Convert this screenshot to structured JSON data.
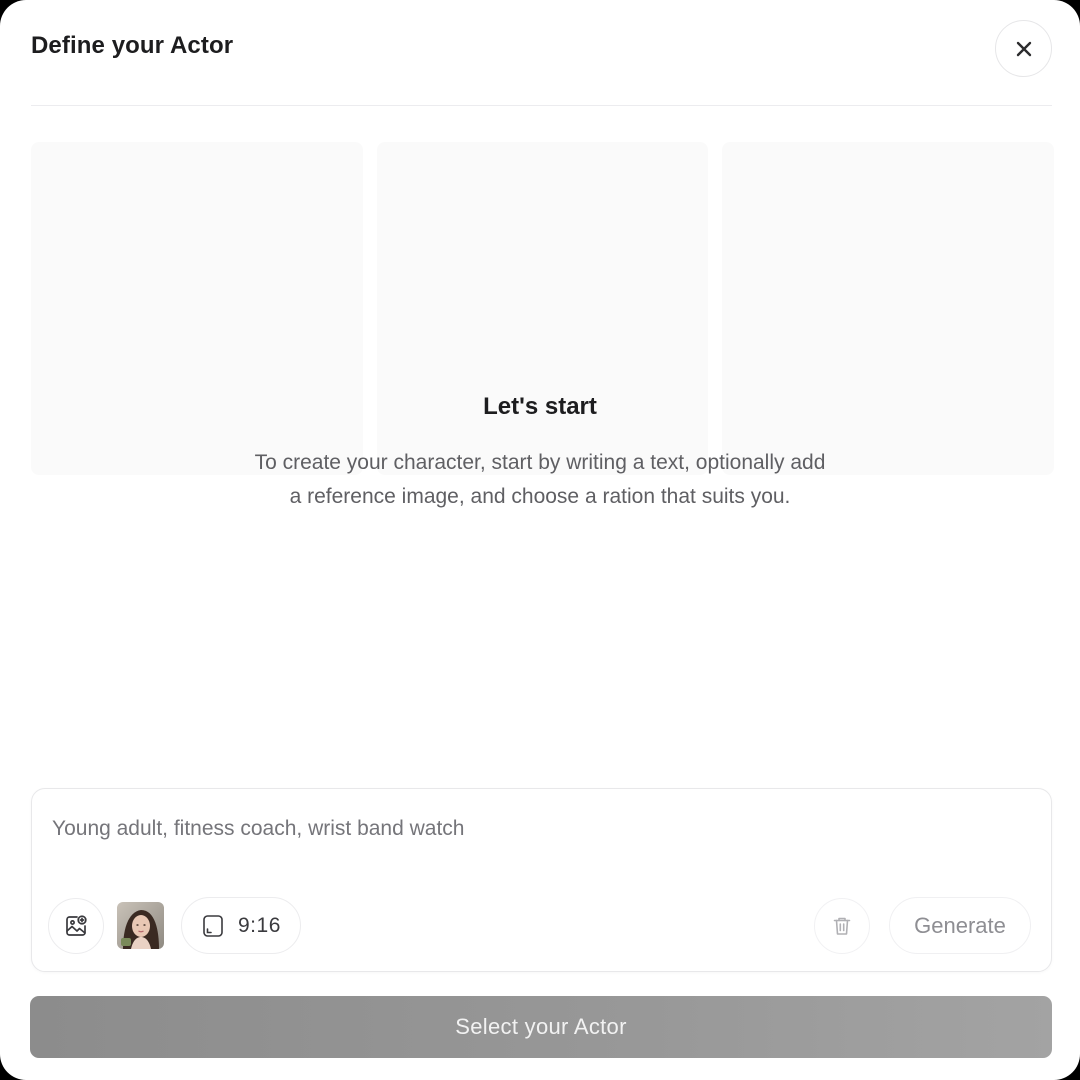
{
  "modal": {
    "title": "Define your Actor",
    "close_icon": "close-icon"
  },
  "empty_state": {
    "title": "Let's start",
    "description_line1": "To create your character, start by writing a text, optionally add",
    "description_line2": "a reference image, and choose a ration that suits you."
  },
  "prompt": {
    "placeholder": "Young adult, fitness coach, wrist band watch",
    "value": "",
    "add_image_icon": "image-add-icon",
    "reference_thumbnail": "reference-photo",
    "aspect_ratio": "9:16",
    "aspect_ratio_icon": "aspect-ratio-icon",
    "delete_icon": "trash-icon",
    "generate_label": "Generate"
  },
  "footer": {
    "select_label": "Select your Actor"
  },
  "colors": {
    "title_text": "#1d1d1f",
    "body_text": "#5f5f63",
    "placeholder_tile": "#fafafa",
    "select_button": "#8c8c8c",
    "border": "#e8e8ea"
  }
}
